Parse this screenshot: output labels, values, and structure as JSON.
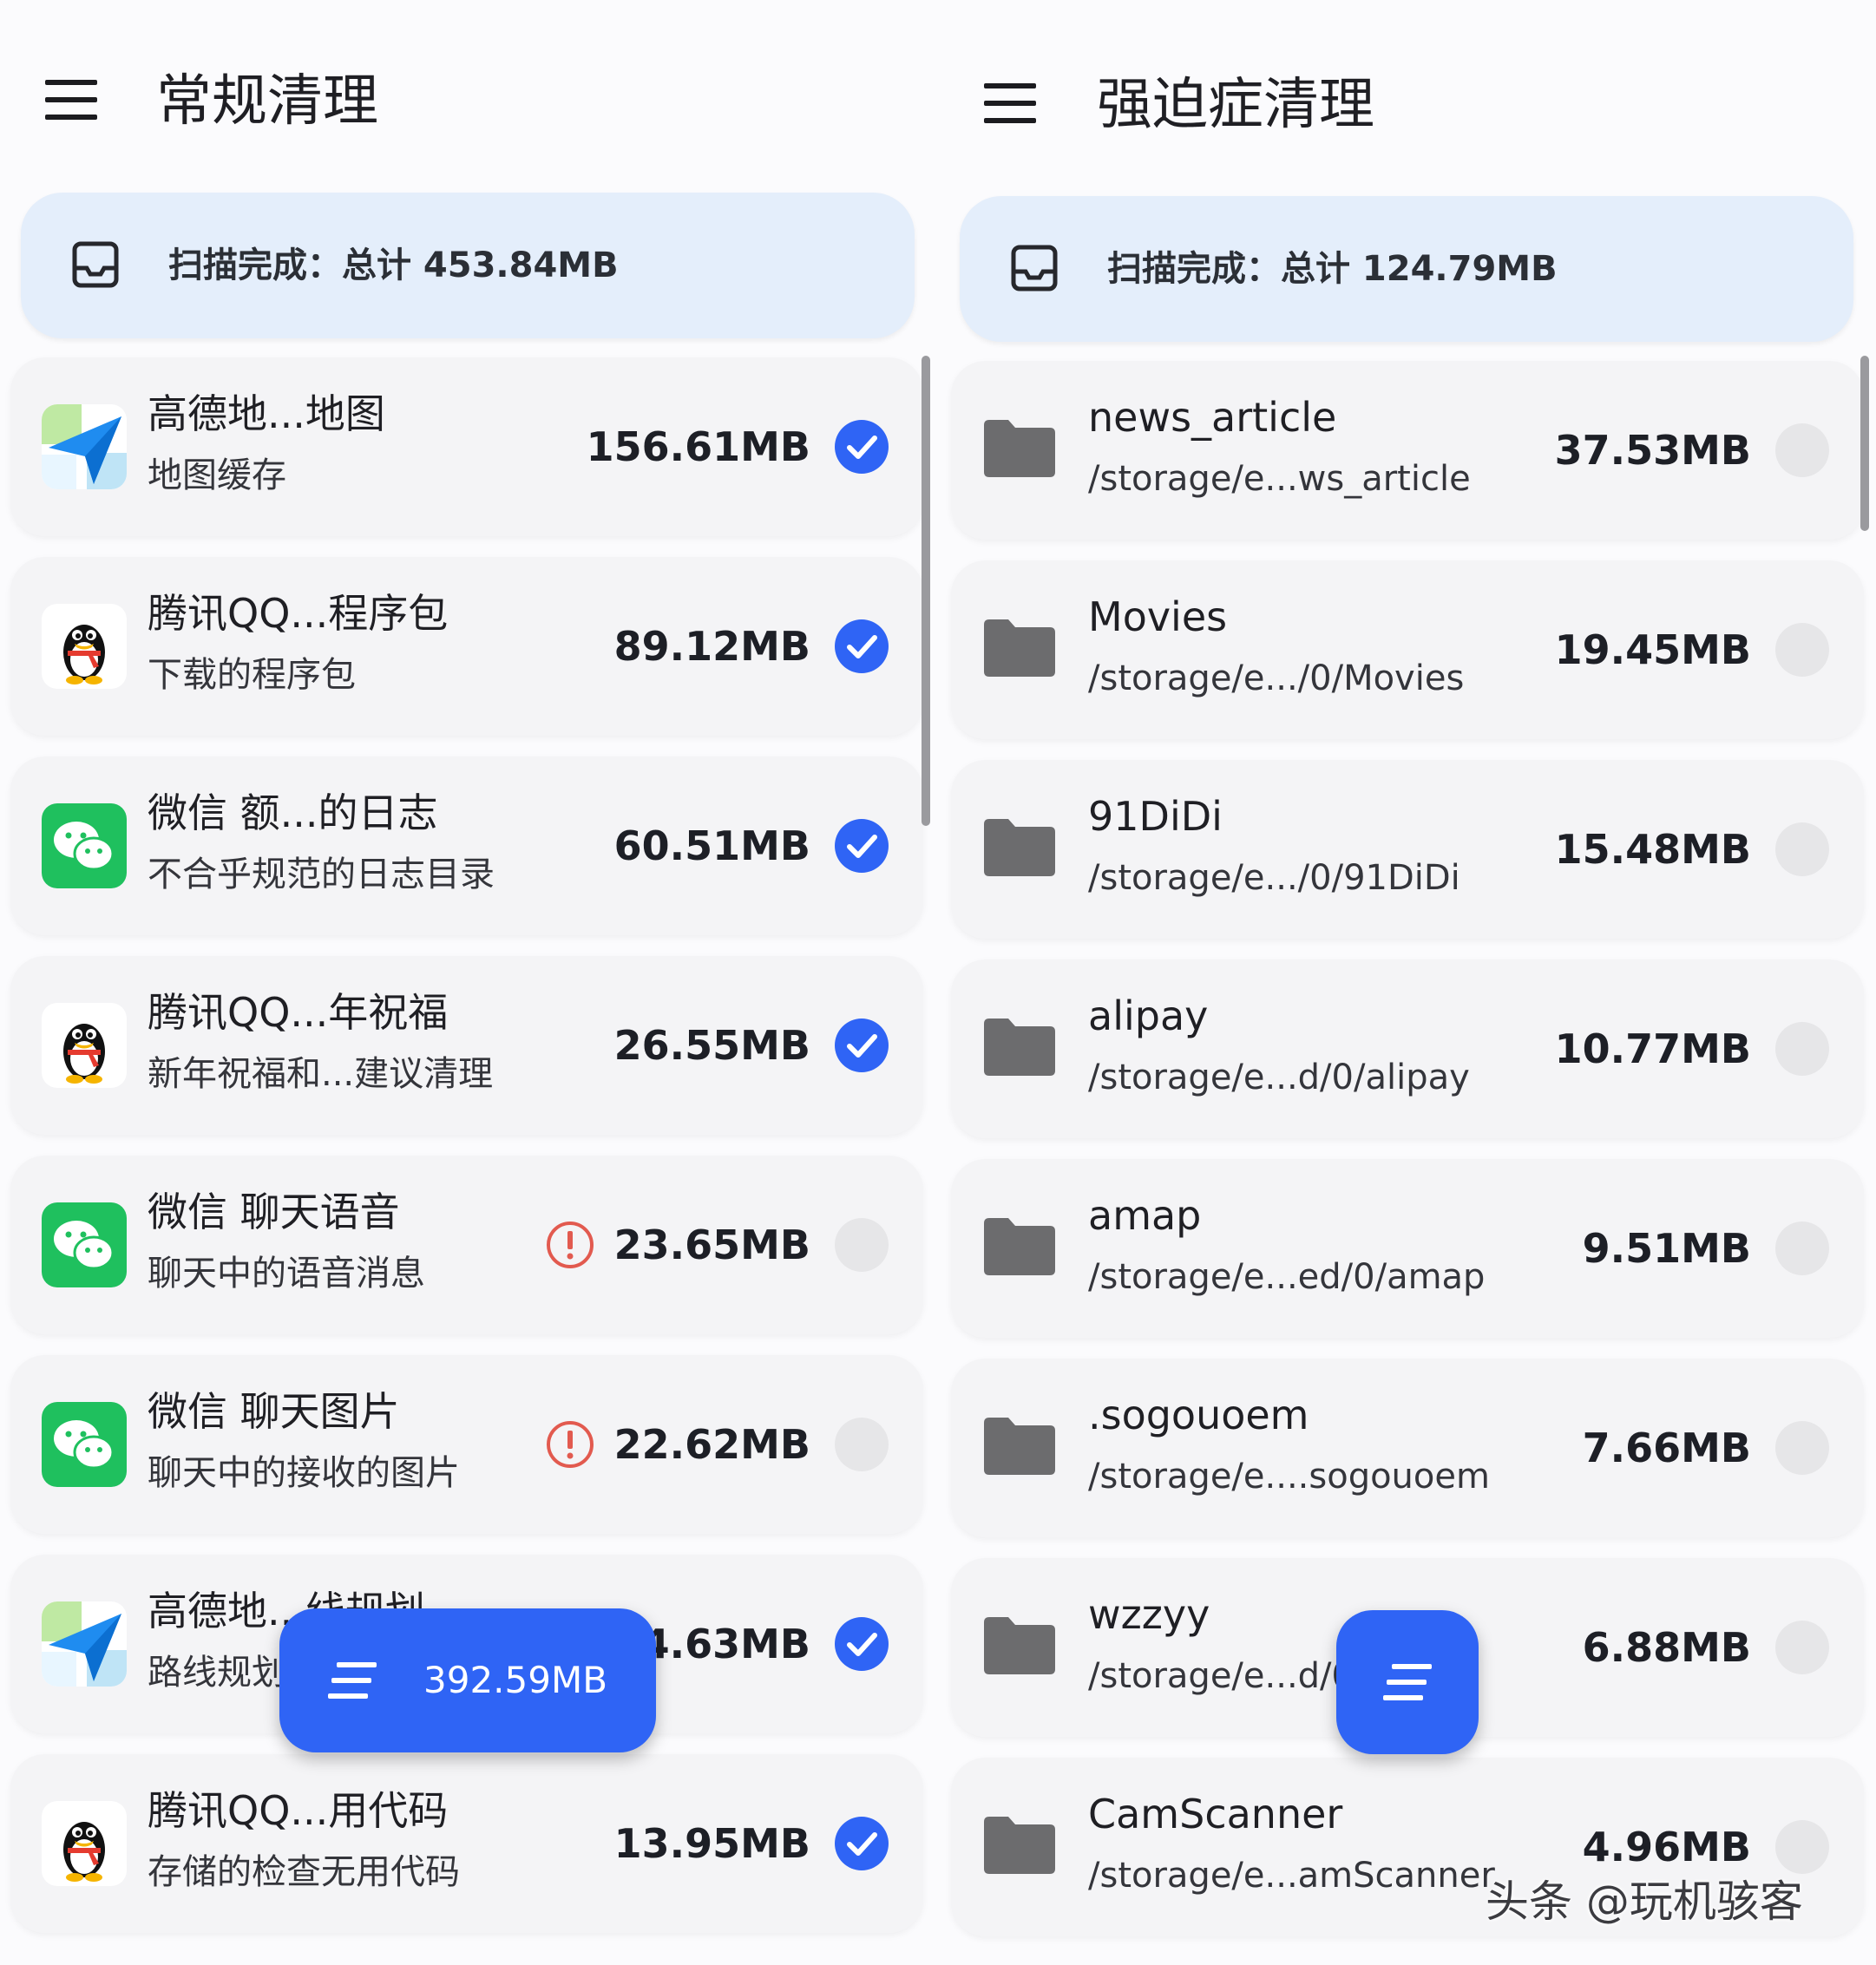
{
  "left": {
    "title": "常规清理",
    "status": "扫描完成：总计 453.84MB",
    "items": [
      {
        "title": "高德地...地图",
        "subtitle": "地图缓存",
        "size": "156.61MB",
        "icon": "amap-app-icon",
        "checked": true,
        "warning": false
      },
      {
        "title": "腾讯QQ...程序包",
        "subtitle": "下载的程序包",
        "size": "89.12MB",
        "icon": "qq-app-icon",
        "checked": true,
        "warning": false
      },
      {
        "title": "微信 额...的日志",
        "subtitle": "不合乎规范的日志目录",
        "size": "60.51MB",
        "icon": "wechat-app-icon",
        "checked": true,
        "warning": false
      },
      {
        "title": "腾讯QQ...年祝福",
        "subtitle": "新年祝福和...建议清理",
        "size": "26.55MB",
        "icon": "qq-app-icon",
        "checked": true,
        "warning": false
      },
      {
        "title": "微信 聊天语音",
        "subtitle": "聊天中的语音消息",
        "size": "23.65MB",
        "icon": "wechat-app-icon",
        "checked": false,
        "warning": true
      },
      {
        "title": "微信 聊天图片",
        "subtitle": "聊天中的接收的图片",
        "size": "22.62MB",
        "icon": "wechat-app-icon",
        "checked": false,
        "warning": true
      },
      {
        "title": "高德地...线规划",
        "subtitle": "路线规划",
        "size": "14.63MB",
        "icon": "amap-app-icon",
        "checked": true,
        "warning": false
      },
      {
        "title": "腾讯QQ...用代码",
        "subtitle": "存储的检查无用代码",
        "size": "13.95MB",
        "icon": "qq-app-icon",
        "checked": true,
        "warning": false
      }
    ],
    "fab_label": "392.59MB"
  },
  "right": {
    "title": "强迫症清理",
    "status": "扫描完成：总计 124.79MB",
    "items": [
      {
        "title": "news_article",
        "subtitle": "/storage/e...ws_article",
        "size": "37.53MB",
        "checked": false
      },
      {
        "title": "Movies",
        "subtitle": "/storage/e.../0/Movies",
        "size": "19.45MB",
        "checked": false
      },
      {
        "title": "91DiDi",
        "subtitle": "/storage/e.../0/91DiDi",
        "size": "15.48MB",
        "checked": false
      },
      {
        "title": "alipay",
        "subtitle": "/storage/e...d/0/alipay",
        "size": "10.77MB",
        "checked": false
      },
      {
        "title": "amap",
        "subtitle": "/storage/e...ed/0/amap",
        "size": "9.51MB",
        "checked": false
      },
      {
        "title": ".sogouoem",
        "subtitle": "/storage/e....sogouoem",
        "size": "7.66MB",
        "checked": false
      },
      {
        "title": "wzzyy",
        "subtitle": "/storage/e...d/0/wzzyy",
        "size": "6.88MB",
        "checked": false
      },
      {
        "title": "CamScanner",
        "subtitle": "/storage/e...amScanner",
        "size": "4.96MB",
        "checked": false
      }
    ]
  },
  "watermark": "头条 @玩机骇客",
  "colors": {
    "accent": "#2f64f5",
    "status_card": "#e4eefb",
    "warning": "#e25a4f",
    "row_bg": "#f4f4f6"
  }
}
